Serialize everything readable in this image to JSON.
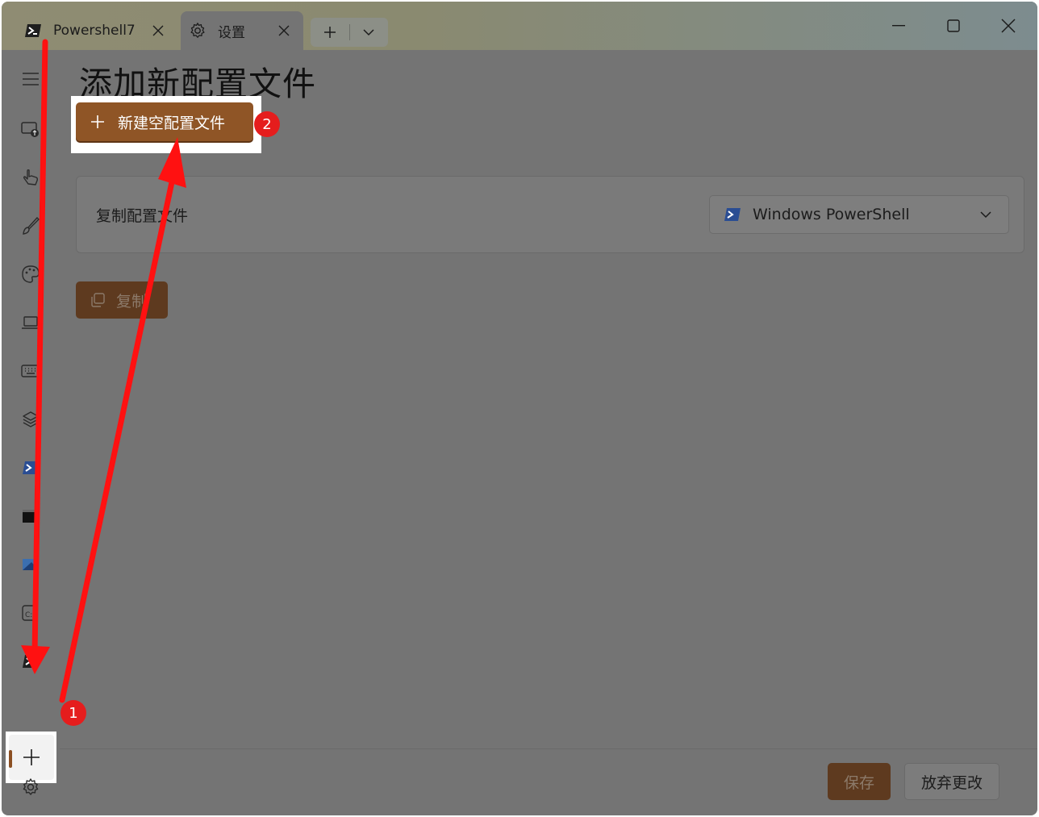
{
  "tabs": [
    {
      "label": "Powershell7",
      "icon": "powershell-icon"
    },
    {
      "label": "设置",
      "icon": "gear-icon"
    }
  ],
  "page": {
    "title": "添加新配置文件",
    "new_empty_label": "新建空配置文件",
    "duplicate_row_label": "复制配置文件",
    "duplicate_dropdown_value": "Windows PowerShell",
    "duplicate_button_label": "复制"
  },
  "footer": {
    "save_label": "保存",
    "discard_label": "放弃更改"
  },
  "annotations": {
    "badge1": "1",
    "badge2": "2"
  },
  "colors": {
    "accent": "#8f5526",
    "annotation_red": "#e51d1d"
  }
}
